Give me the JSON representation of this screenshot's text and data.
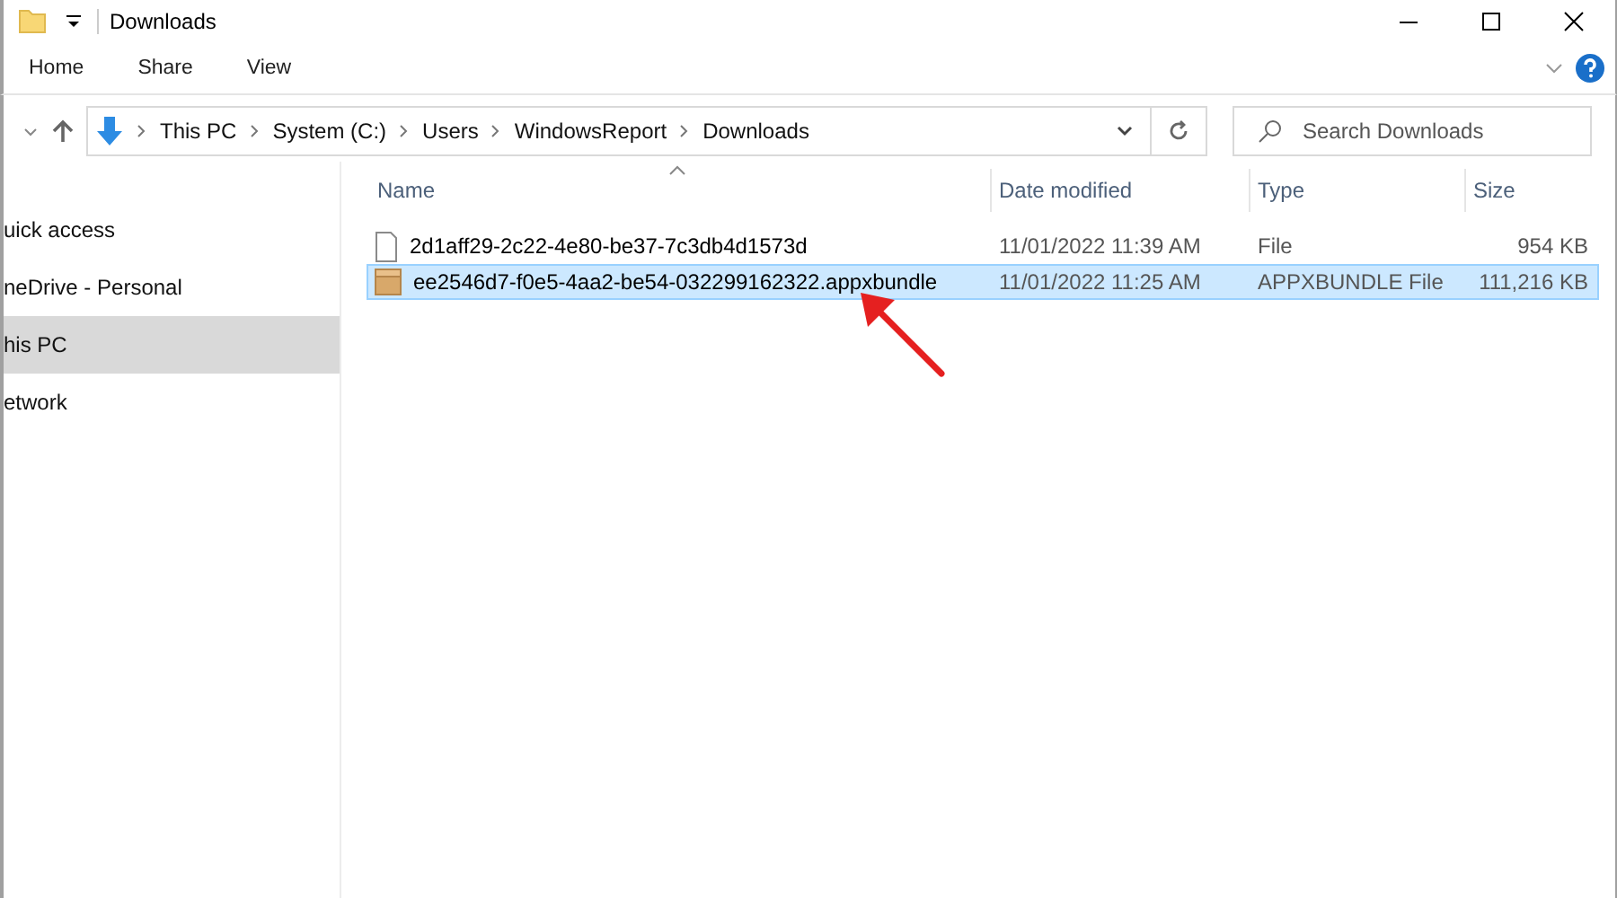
{
  "window": {
    "title": "Downloads"
  },
  "ribbon_tabs": [
    {
      "label": "Home"
    },
    {
      "label": "Share"
    },
    {
      "label": "View"
    }
  ],
  "address": {
    "crumbs": [
      "This PC",
      "System (C:)",
      "Users",
      "WindowsReport",
      "Downloads"
    ]
  },
  "search": {
    "placeholder": "Search Downloads"
  },
  "sidebar": {
    "items": [
      {
        "label": "uick access",
        "selected": false
      },
      {
        "label": "neDrive - Personal",
        "selected": false
      },
      {
        "label": "his PC",
        "selected": true
      },
      {
        "label": "etwork",
        "selected": false
      }
    ]
  },
  "table": {
    "columns": [
      "Name",
      "Date modified",
      "Type",
      "Size"
    ],
    "rows": [
      {
        "kind": "file",
        "name": "2d1aff29-2c22-4e80-be37-7c3db4d1573d",
        "date": "11/01/2022 11:39 AM",
        "type": "File",
        "size": "954 KB",
        "selected": false
      },
      {
        "kind": "package",
        "name": "ee2546d7-f0e5-4aa2-be54-032299162322.appxbundle",
        "date": "11/01/2022 11:25 AM",
        "type": "APPXBUNDLE File",
        "size": "111,216 KB",
        "selected": true
      }
    ]
  }
}
